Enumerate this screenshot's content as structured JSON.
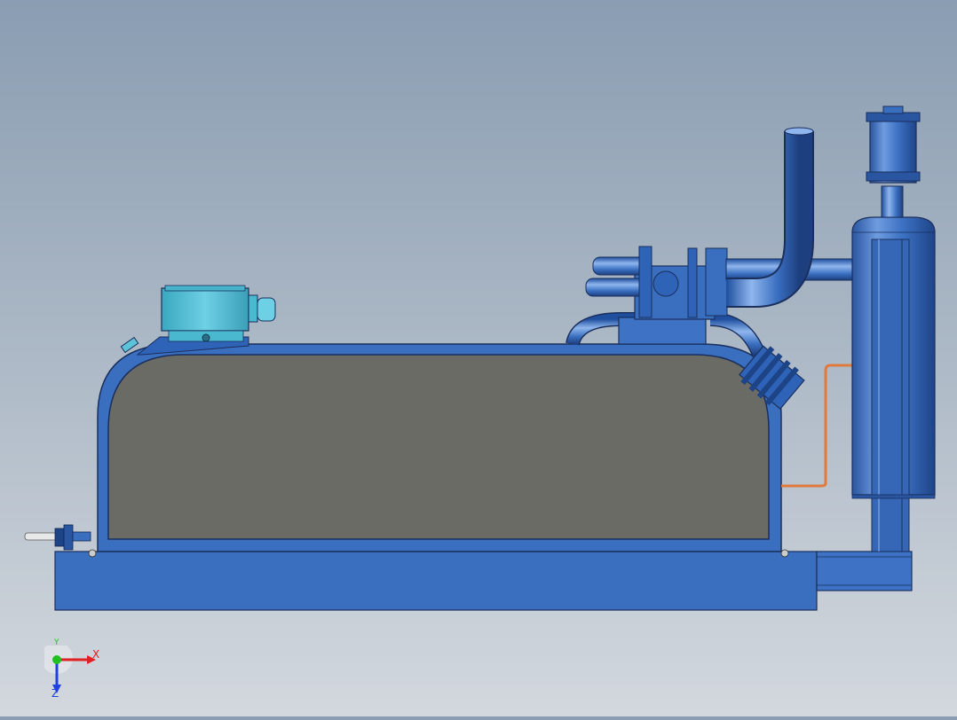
{
  "viewport": {
    "background_top": "#8a9db2",
    "background_bottom": "#d3d8de"
  },
  "model": {
    "body_color": "#3a6fc0",
    "panel_color": "#6b6b66",
    "motor_box_color": "#5cc3d8",
    "hose_color": "#e07a3c",
    "components": [
      "tank",
      "base-frame",
      "motor-junction-box",
      "pump-head",
      "exhaust-pipe",
      "separator-vessel",
      "vacuum-valve",
      "drain-hose",
      "level-sensor"
    ]
  },
  "triad": {
    "x_label": "X",
    "y_label": "Y",
    "z_label": "Z",
    "x_color": "#e02020",
    "y_color": "#20c020",
    "z_color": "#2040e0"
  }
}
